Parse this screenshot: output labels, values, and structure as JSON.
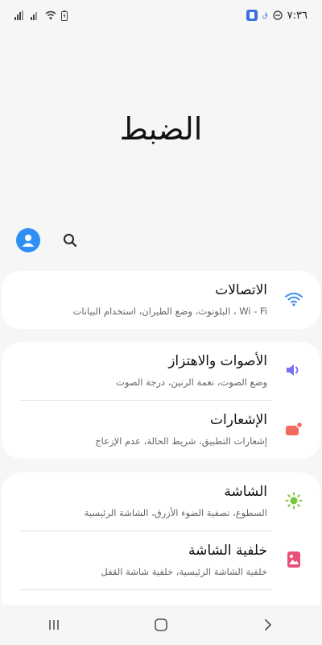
{
  "status_bar": {
    "time": "٧:٣٦",
    "small_icon_label": "ق"
  },
  "page": {
    "title": "الضبط"
  },
  "sections": {
    "connections": {
      "title": "الاتصالات",
      "subtitle": "Wi - Fi ، البلوتوث، وضع الطيران، استخدام البيانات"
    },
    "sounds": {
      "title": "الأصوات والاهتزاز",
      "subtitle": "وضع الصوت، نغمة الرنين، درجة الصوت"
    },
    "notifications": {
      "title": "الإشعارات",
      "subtitle": "إشعارات التطبيق، شريط الحالة، عدم الإزعاج"
    },
    "display": {
      "title": "الشاشة",
      "subtitle": "السطوع، تصفية الضوء الأزرق، الشاشة الرئيسية"
    },
    "wallpaper": {
      "title": "خلفية الشاشة",
      "subtitle": "خلفية الشاشة الرئيسية، خلفية شاشة القفل"
    }
  },
  "colors": {
    "accent_blue": "#2f8ff5",
    "wifi_blue": "#3b8ef0",
    "sound_purple": "#7a6ff0",
    "notif_coral": "#f26a5f",
    "display_green": "#7cc63a",
    "wallpaper_pink": "#e9517a"
  }
}
